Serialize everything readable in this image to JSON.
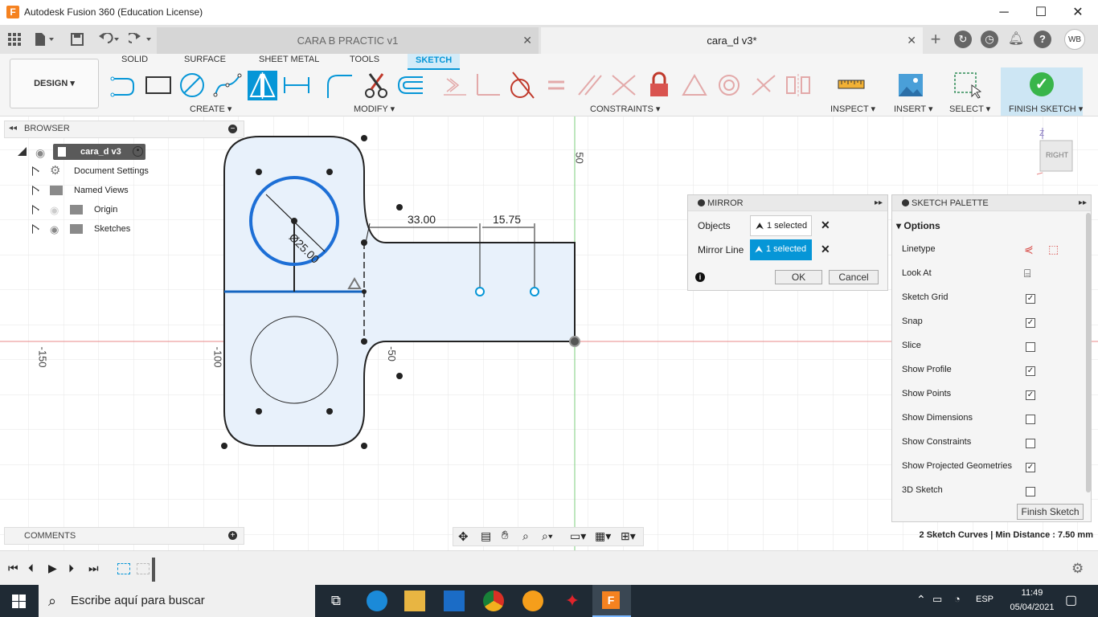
{
  "window": {
    "title": "Autodesk Fusion 360 (Education License)",
    "min": "─",
    "max": "☐",
    "close": "✕",
    "logo": "F"
  },
  "tabs": [
    {
      "label": "CARA B PRACTIC v1",
      "close": "✕"
    },
    {
      "label": "cara_d v3*",
      "close": "✕"
    }
  ],
  "user_initials": "WB",
  "design_button": "DESIGN ▾",
  "menu_tabs": [
    "SOLID",
    "SURFACE",
    "SHEET METAL",
    "TOOLS",
    "SKETCH"
  ],
  "tool_groups": [
    "CREATE ▾",
    "MODIFY ▾",
    "CONSTRAINTS ▾",
    "INSPECT ▾",
    "INSERT ▾",
    "SELECT ▾",
    "FINISH SKETCH ▾"
  ],
  "browser": {
    "title": "BROWSER",
    "root": "cara_d v3",
    "items": [
      "Document Settings",
      "Named Views",
      "Origin",
      "Sketches"
    ]
  },
  "comments": "COMMENTS",
  "mirror": {
    "title": "MIRROR",
    "objects_label": "Objects",
    "objects_value": "1 selected",
    "mirror_line_label": "Mirror Line",
    "mirror_line_value": "1 selected",
    "ok": "OK",
    "cancel": "Cancel"
  },
  "palette": {
    "title": "SKETCH PALETTE",
    "section": "Options",
    "rows": [
      {
        "label": "Linetype",
        "kind": "icons"
      },
      {
        "label": "Look At",
        "kind": "icon"
      },
      {
        "label": "Sketch Grid",
        "checked": true
      },
      {
        "label": "Snap",
        "checked": true
      },
      {
        "label": "Slice",
        "checked": false
      },
      {
        "label": "Show Profile",
        "checked": true
      },
      {
        "label": "Show Points",
        "checked": true
      },
      {
        "label": "Show Dimensions",
        "checked": false
      },
      {
        "label": "Show Constraints",
        "checked": false
      },
      {
        "label": "Show Projected Geometries",
        "checked": true
      },
      {
        "label": "3D Sketch",
        "checked": false
      }
    ],
    "finish_button": "Finish Sketch"
  },
  "status": "2 Sketch Curves | Min Distance : 7.50 mm",
  "viewcube": {
    "face": "RIGHT",
    "axis": "Z"
  },
  "sketch": {
    "dim_33": "33.00",
    "dim_1575": "15.75",
    "dim_dia": "Ø25.00",
    "axis_labels": [
      "-150",
      "-100",
      "-50",
      "50"
    ]
  },
  "taskbar": {
    "search_placeholder": "Escribe aquí para buscar",
    "lang": "ESP",
    "time": "11:49",
    "date": "05/04/2021"
  },
  "colors": {
    "accent": "#0696d7",
    "finish_green": "#39b54a",
    "profile_fill": "#e8f1fb",
    "axis_red": "#e88888",
    "axis_green": "#7ccf7c"
  }
}
